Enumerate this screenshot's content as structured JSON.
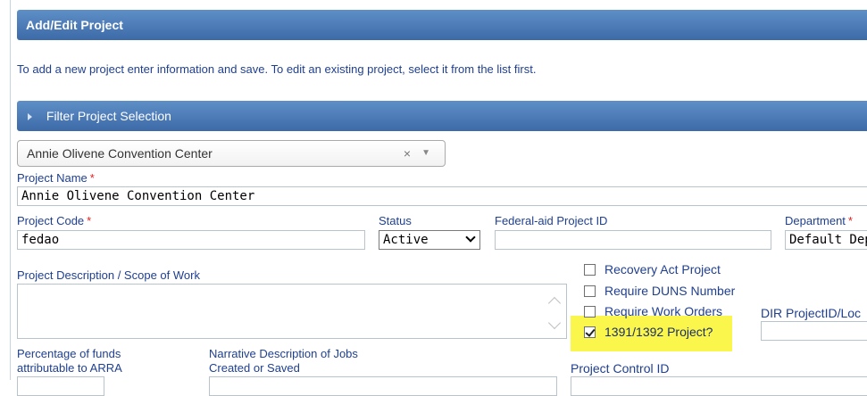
{
  "header": {
    "title": "Add/Edit Project"
  },
  "intro": {
    "text": "To add a new project enter information and save. To edit an existing project, select it from the list first."
  },
  "filter": {
    "label": "Filter Project Selection"
  },
  "project_select": {
    "value": "Annie Olivene Convention Center",
    "clear_icon": "×",
    "arrow_icon": "▼"
  },
  "project_name": {
    "label": "Project Name",
    "required": "*",
    "value": "Annie Olivene Convention Center"
  },
  "project_code": {
    "label": "Project Code",
    "required": "*",
    "value": "fedao"
  },
  "status": {
    "label": "Status",
    "value": "Active"
  },
  "federal_aid": {
    "label": "Federal-aid Project ID",
    "value": ""
  },
  "department": {
    "label": "Department",
    "required": "*",
    "value": "Default Dep"
  },
  "description": {
    "label": "Project Description / Scope of Work",
    "value": ""
  },
  "checkboxes": [
    {
      "label": "Recovery Act Project",
      "checked": false
    },
    {
      "label": "Require DUNS Number",
      "checked": false
    },
    {
      "label": "Require Work Orders",
      "checked": false
    },
    {
      "label": "1391/1392 Project?",
      "checked": true
    }
  ],
  "dir_project": {
    "label": "DIR ProjectID/Loc"
  },
  "arra": {
    "label_line1": "Percentage of funds",
    "label_line2": "attributable to ARRA"
  },
  "narrative": {
    "label_line1": "Narrative Description of Jobs",
    "label_line2": "Created or Saved"
  },
  "project_control": {
    "label": "Project Control ID"
  },
  "colors": {
    "accent": "#4a78b4",
    "label": "#1f3f8f",
    "required": "#e02020",
    "highlight": "#fbf64c"
  }
}
